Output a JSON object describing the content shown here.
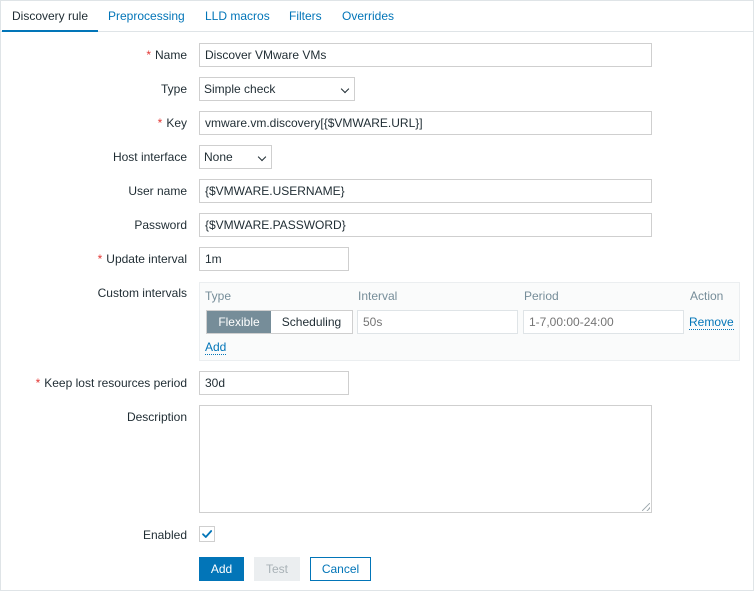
{
  "tabs": [
    {
      "label": "Discovery rule",
      "active": true
    },
    {
      "label": "Preprocessing",
      "active": false
    },
    {
      "label": "LLD macros",
      "active": false
    },
    {
      "label": "Filters",
      "active": false
    },
    {
      "label": "Overrides",
      "active": false
    }
  ],
  "form": {
    "name": {
      "label": "Name",
      "required": "*",
      "value": "Discover VMware VMs"
    },
    "type": {
      "label": "Type",
      "value": "Simple check"
    },
    "key": {
      "label": "Key",
      "required": "*",
      "value": "vmware.vm.discovery[{$VMWARE.URL}]"
    },
    "host_interface": {
      "label": "Host interface",
      "value": "None"
    },
    "user_name": {
      "label": "User name",
      "value": "{$VMWARE.USERNAME}"
    },
    "password": {
      "label": "Password",
      "value": "{$VMWARE.PASSWORD}"
    },
    "update_interval": {
      "label": "Update interval",
      "required": "*",
      "value": "1m"
    },
    "custom_intervals": {
      "label": "Custom intervals",
      "headers": {
        "type": "Type",
        "interval": "Interval",
        "period": "Period",
        "action": "Action"
      },
      "mode_flexible": "Flexible",
      "mode_scheduling": "Scheduling",
      "active_mode": "Flexible",
      "interval_placeholder": "50s",
      "period_placeholder": "1-7,00:00-24:00",
      "remove_label": "Remove",
      "add_label": "Add"
    },
    "keep_lost": {
      "label": "Keep lost resources period",
      "required": "*",
      "value": "30d"
    },
    "description": {
      "label": "Description",
      "value": ""
    },
    "enabled": {
      "label": "Enabled",
      "checked": true
    }
  },
  "buttons": {
    "add": "Add",
    "test": "Test",
    "cancel": "Cancel"
  },
  "colors": {
    "link": "#0275b8",
    "required": "#e33734",
    "segment_active": "#768d99"
  },
  "icons": {
    "checkbox_checked": "check-icon",
    "select_dropdown": "chevron-down-icon"
  }
}
